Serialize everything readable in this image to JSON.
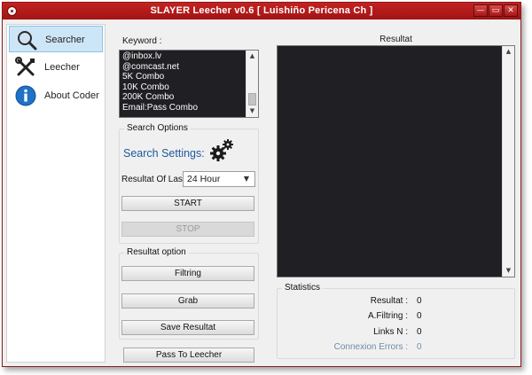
{
  "window": {
    "title": "SLAYER Leecher v0.6 [ Luishiño Pericena Ch ]",
    "controls": [
      "—",
      "▭",
      "✕"
    ]
  },
  "sidebar": {
    "items": [
      {
        "label": "Searcher",
        "icon": "magnifier-icon",
        "active": true
      },
      {
        "label": "Leecher",
        "icon": "tools-icon",
        "active": false
      },
      {
        "label": "About Coder",
        "icon": "info-icon",
        "active": false
      }
    ]
  },
  "keyword": {
    "label": "Keyword :",
    "lines": [
      "@inbox.lv",
      "@comcast.net",
      "5K Combo",
      "10K Combo",
      "200K Combo",
      "Email:Pass Combo"
    ]
  },
  "search_options": {
    "title": "Search Options",
    "settings_title": "Search Settings:",
    "resultat_of_last_label": "Resultat Of Last",
    "resultat_of_last_value": "24 Hour",
    "start_label": "START",
    "stop_label": "STOP"
  },
  "resultat_option": {
    "title": "Resultat option",
    "filtring_label": "Filtring",
    "grab_label": "Grab",
    "save_label": "Save Resultat"
  },
  "pass_to_leecher_label": "Pass To Leecher",
  "resultat_panel": {
    "title": "Resultat"
  },
  "statistics": {
    "title": "Statistics",
    "rows": [
      {
        "label": "Resultat :",
        "value": "0"
      },
      {
        "label": "A.Filtring :",
        "value": "0"
      },
      {
        "label": "Links N :",
        "value": "0"
      },
      {
        "label": "Connexion Errors :",
        "value": "0"
      }
    ]
  },
  "colors": {
    "titlebar": "#b01a1a",
    "text_dark_bg": "#1f1f24",
    "settings_accent": "#1b5a9c",
    "sidebar_active": "#cde6f7"
  }
}
